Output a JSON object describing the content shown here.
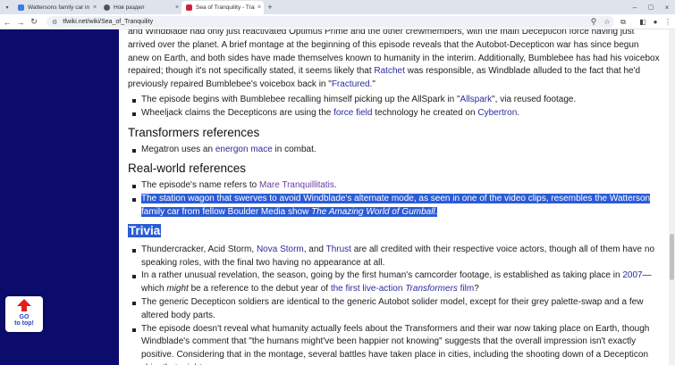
{
  "browser": {
    "tabs": [
      {
        "title": "Wattersons family car in Transfo..."
      },
      {
        "title": "Нов раздел"
      },
      {
        "title": "Sea of Tranquility - Transformers"
      }
    ],
    "new_tab": "+",
    "url": "tfwiki.net/wiki/Sea_of_Tranquility"
  },
  "article": {
    "intro": [
      {
        "t": "and Windblade had only just reactivated Optimus Prime and the other crewmembers, with the main Decepticon force having just arrived over the planet. A brief montage at the beginning of this episode reveals that the Autobot-Decepticon war has since begun anew on Earth, and both sides have made themselves known to humanity in the interim. Additionally, Bumblebee has had his voicebox repaired; though it's not specifically stated, it seems likely that "
      },
      {
        "a": "Ratchet"
      },
      {
        "t": " was responsible, as Windblade alluded to the fact that he'd previously repaired Bumblebee's voicebox back in \""
      },
      {
        "a": "Fractured"
      },
      {
        "t": ".\""
      }
    ],
    "list1": [
      [
        {
          "t": "The episode begins with Bumblebee recalling himself picking up the AllSpark in \""
        },
        {
          "a": "Allspark"
        },
        {
          "t": "\", via reused footage."
        }
      ],
      [
        {
          "t": "Wheeljack claims the Decepticons are using the "
        },
        {
          "a": "force field"
        },
        {
          "t": " technology he created on "
        },
        {
          "a": "Cybertron"
        },
        {
          "t": "."
        }
      ]
    ],
    "h_tf_refs": "Transformers references",
    "list2": [
      [
        {
          "t": "Megatron uses an "
        },
        {
          "a": "energon mace"
        },
        {
          "t": " in combat."
        }
      ]
    ],
    "h_rw_refs": "Real-world references",
    "list3": [
      [
        {
          "t": "The episode's name refers to "
        },
        {
          "av": "Mare Tranquillitatis"
        },
        {
          "t": "."
        }
      ]
    ],
    "list3_selected": [
      {
        "t": "The station wagon that swerves to avoid Windblade's alternate mode, as seen in one of the video clips, resembles the Watterson family car from fellow Boulder Media show "
      },
      {
        "i": "The Amazing World of Gumball"
      },
      {
        "t": "."
      }
    ],
    "h_trivia": "Trivia",
    "list4": [
      [
        {
          "t": "Thundercracker, Acid Storm, "
        },
        {
          "a": "Nova Storm"
        },
        {
          "t": ", and "
        },
        {
          "a": "Thrust"
        },
        {
          "t": " are all credited with their respective voice actors, though all of them have no speaking roles, with the final two having no appearance at all."
        }
      ],
      [
        {
          "t": "In a rather unusual revelation, the season, going by the first human's camcorder footage, is established as taking place in "
        },
        {
          "a": "2007"
        },
        {
          "t": "—which "
        },
        {
          "i": "might"
        },
        {
          "t": " be a reference to the debut year of "
        },
        {
          "a": "the first live-action "
        },
        {
          "ai": "Transformers"
        },
        {
          "a": " film"
        },
        {
          "t": "?"
        }
      ],
      [
        {
          "t": "The generic Decepticon soldiers are identical to the generic Autobot solider model, except for their grey palette-swap and a few altered body parts."
        }
      ],
      [
        {
          "t": "The episode doesn't reveal what humanity actually feels about the Transformers and their war now taking place on Earth, though Windblade's comment that \"the humans might've been happier not knowing\" suggests that the overall impression isn't exactly positive. Considering that in the montage, several battles have taken place in cities, including the shooting down of a Decepticon ship, that might"
        }
      ]
    ]
  },
  "go_to_top": {
    "line1": "GO",
    "line2": "to top!"
  },
  "colors": {
    "page_bg": "#0c0c6c",
    "link": "#2c2c9e",
    "visited": "#6b3ba0",
    "selection": "#2b5cd6"
  }
}
